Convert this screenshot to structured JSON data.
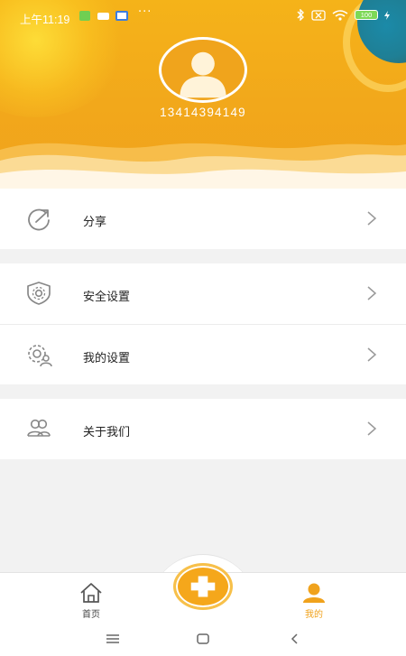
{
  "status_bar": {
    "time": "上午11:19",
    "overflow": "···",
    "battery": "100",
    "icons": [
      "sim-badge-icon",
      "message-icon",
      "app-icon",
      "bluetooth-icon",
      "sim-off-icon",
      "wifi-icon",
      "battery-icon",
      "charging-icon"
    ]
  },
  "profile": {
    "avatar_icon": "user-avatar-icon",
    "phone": "13414394149"
  },
  "menu": {
    "groups": [
      [
        {
          "label": "分享",
          "icon": "share-icon"
        }
      ],
      [
        {
          "label": "安全设置",
          "icon": "shield-icon"
        },
        {
          "label": "我的设置",
          "icon": "user-gear-icon"
        }
      ],
      [
        {
          "label": "关于我们",
          "icon": "users-icon"
        }
      ]
    ]
  },
  "bottom_nav": {
    "home_label": "首页",
    "center_icon": "plus-icon",
    "mine_label": "我的"
  },
  "system_nav": {
    "icons": [
      "menu-icon",
      "home-square-icon",
      "back-icon"
    ]
  },
  "colors": {
    "accent": "#f0a21c",
    "header_top": "#f5b319",
    "text": "#222222",
    "icon_gray": "#8a8a8a",
    "background": "#f2f2f2"
  }
}
